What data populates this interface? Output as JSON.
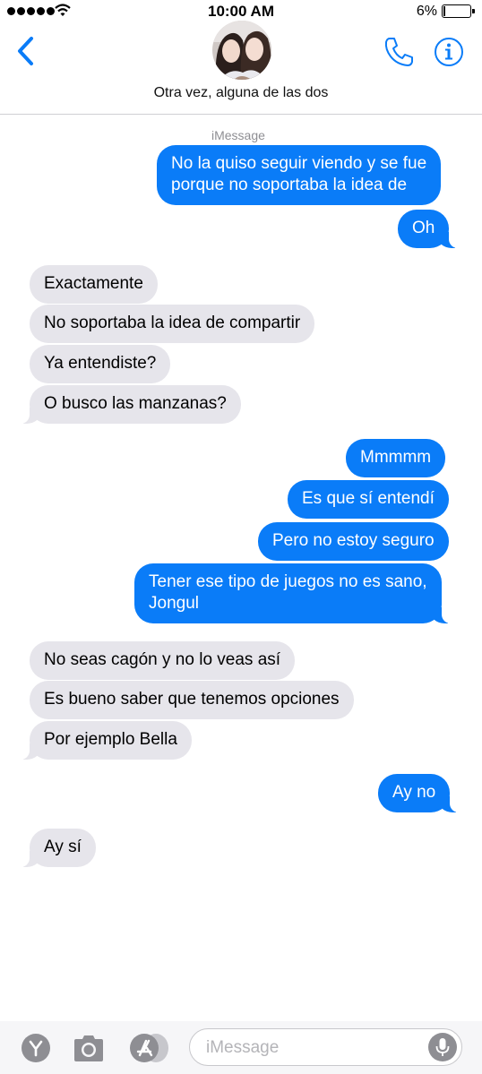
{
  "status_bar": {
    "time": "10:00 AM",
    "battery_percent": "6%",
    "battery_level": 0.06,
    "signal_bars": 5,
    "icons": [
      "signal-dots-icon",
      "wifi-icon",
      "battery-icon"
    ]
  },
  "header": {
    "contact_name": "Otra vez, alguna de las dos",
    "icons": [
      "chevron-left-icon",
      "phone-icon",
      "info-icon"
    ],
    "accent_color": "#0a7cf8"
  },
  "conversation": {
    "service_label": "iMessage",
    "messages": [
      {
        "from": "me",
        "lines": [
          "No la quiso seguir viendo y se fue",
          "porque no soportaba la idea de"
        ]
      },
      {
        "from": "me",
        "lines": [
          "Oh"
        ]
      },
      {
        "from": "them",
        "lines": [
          "Exactamente"
        ]
      },
      {
        "from": "them",
        "lines": [
          "No soportaba la idea de compartir"
        ]
      },
      {
        "from": "them",
        "lines": [
          "Ya entendiste?"
        ]
      },
      {
        "from": "them",
        "lines": [
          "O busco las manzanas?"
        ]
      },
      {
        "from": "me",
        "lines": [
          "Mmmmm"
        ]
      },
      {
        "from": "me",
        "lines": [
          "Es que sí entendí"
        ]
      },
      {
        "from": "me",
        "lines": [
          "Pero no estoy seguro"
        ]
      },
      {
        "from": "me",
        "lines": [
          "Tener ese tipo de juegos no es sano,",
          "Jongul"
        ]
      },
      {
        "from": "them",
        "lines": [
          "No seas cagón y no lo veas así"
        ]
      },
      {
        "from": "them",
        "lines": [
          "Es bueno saber que tenemos opciones"
        ]
      },
      {
        "from": "them",
        "lines": [
          "Por ejemplo Bella"
        ]
      },
      {
        "from": "me",
        "lines": [
          "Ay no"
        ]
      },
      {
        "from": "them",
        "lines": [
          "Ay sí"
        ]
      }
    ],
    "colors": {
      "outgoing": "#0a7cf8",
      "incoming": "#e6e5eb"
    }
  },
  "input_bar": {
    "placeholder": "iMessage",
    "value": "",
    "icons": [
      "apps-icon",
      "camera-icon",
      "app-store-icon",
      "microphone-icon"
    ]
  }
}
